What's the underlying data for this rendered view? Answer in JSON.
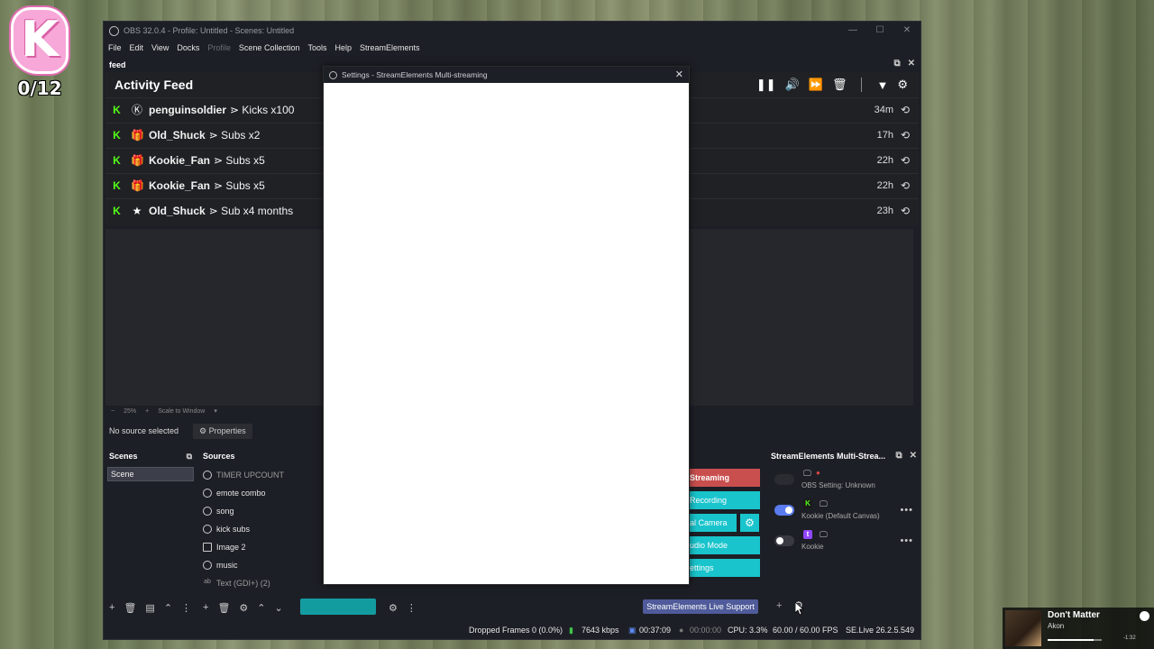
{
  "overlay": {
    "badge_letter": "K",
    "counter": "0/12"
  },
  "window": {
    "title": "OBS 32.0.4 - Profile: Untitled - Scenes: Untitled",
    "controls": [
      "—",
      "☐",
      "✕"
    ]
  },
  "menu": [
    "File",
    "Edit",
    "View",
    "Docks",
    "Profile",
    "Scene Collection",
    "Tools",
    "Help",
    "StreamElements"
  ],
  "feed_dock": {
    "name": "feed",
    "heading": "Activity Feed",
    "rows": [
      {
        "user": "penguinsoldier",
        "event": "⋗ Kicks x100",
        "time": "34m",
        "icon": "kick-icon"
      },
      {
        "user": "Old_Shuck",
        "event": "⋗ Subs x2",
        "time": "17h",
        "icon": "gift-icon"
      },
      {
        "user": "Kookie_Fan",
        "event": "⋗ Subs x5",
        "time": "22h",
        "icon": "gift-icon"
      },
      {
        "user": "Kookie_Fan",
        "event": "⋗ Subs x5",
        "time": "22h",
        "icon": "gift-icon"
      },
      {
        "user": "Old_Shuck",
        "event": "⋗ Sub x4 months",
        "time": "23h",
        "icon": "star-icon"
      }
    ]
  },
  "preview": {
    "zoom": "25%",
    "scale_mode": "Scale to Window"
  },
  "source_toolbar": {
    "no_source": "No source selected",
    "properties": "Properties"
  },
  "scenes": {
    "heading": "Scenes",
    "items": [
      "Scene"
    ]
  },
  "sources": {
    "heading": "Sources",
    "items": [
      "TIMER UPCOUNT",
      "emote combo",
      "song",
      "kick subs",
      "Image 2",
      "music",
      "Text (GDI+) (2)"
    ]
  },
  "controls": {
    "streaming": "Streaming",
    "recording": "Recording",
    "virtual_camera": "al Camera",
    "studio_mode": "udio Mode",
    "settings": "ettings",
    "live_support": "StreamElements Live Support"
  },
  "se_dock": {
    "heading": "StreamElements Multi-Strea...",
    "outputs": [
      {
        "label": "OBS Setting: Unknown",
        "enabled": false
      },
      {
        "label": "Kookie (Default Canvas)",
        "enabled": true,
        "platform": "kick"
      },
      {
        "label": "Kookie",
        "enabled": false,
        "platform": "twitch"
      }
    ]
  },
  "status": {
    "dropped_frames": "Dropped Frames 0 (0.0%)",
    "bitrate": "7643 kbps",
    "stream_time": "00:37:09",
    "record_time": "00:00:00",
    "cpu": "CPU: 3.3%",
    "fps": "60.00 / 60.00 FPS",
    "se_version": "SE.Live 26.2.5.549"
  },
  "settings_dialog": {
    "title": "Settings - StreamElements Multi-streaming"
  },
  "now_playing": {
    "song": "Don't Matter",
    "artist": "Akon",
    "remaining": "-1:32",
    "progress": 0.85
  },
  "colors": {
    "kick_green": "#53fc18",
    "teal": "#19c4cc",
    "stream_red": "#c94f4f",
    "toggle_blue": "#5a7cf0",
    "twitch_purple": "#9146ff"
  }
}
